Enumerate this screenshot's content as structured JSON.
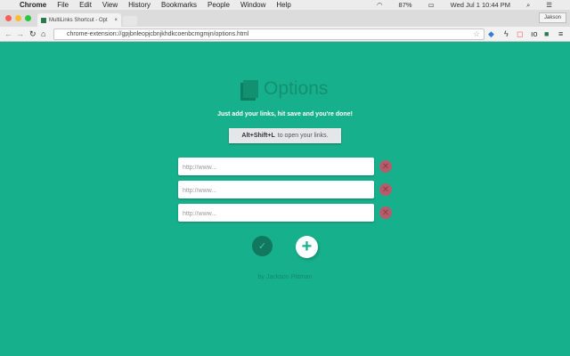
{
  "menubar": {
    "apple": "",
    "app": "Chrome",
    "items": [
      "File",
      "Edit",
      "View",
      "History",
      "Bookmarks",
      "People",
      "Window",
      "Help"
    ],
    "battery": "87%",
    "datetime": "Wed Jul 1  10:44 PM"
  },
  "browser": {
    "tab_title": "MultiLinks Shortcut - Opt",
    "tab_close": "×",
    "profile": "Jakson",
    "url": "chrome-extension://gpjbnleopjcbnjkhdkcoenbcmgmjn/options.html"
  },
  "page": {
    "title": "Options",
    "tagline": "Just add your links, hit save and you're done!",
    "shortcut_keys": "Alt+Shift+L",
    "shortcut_text": "to open your links.",
    "placeholder": "http://www...",
    "links": [
      "",
      "",
      ""
    ],
    "credit_prefix": "by",
    "credit_name": "Jackson Pittman"
  },
  "colors": {
    "background": "#17b08c",
    "delete": "#b65d6b",
    "save": "#11775f"
  }
}
